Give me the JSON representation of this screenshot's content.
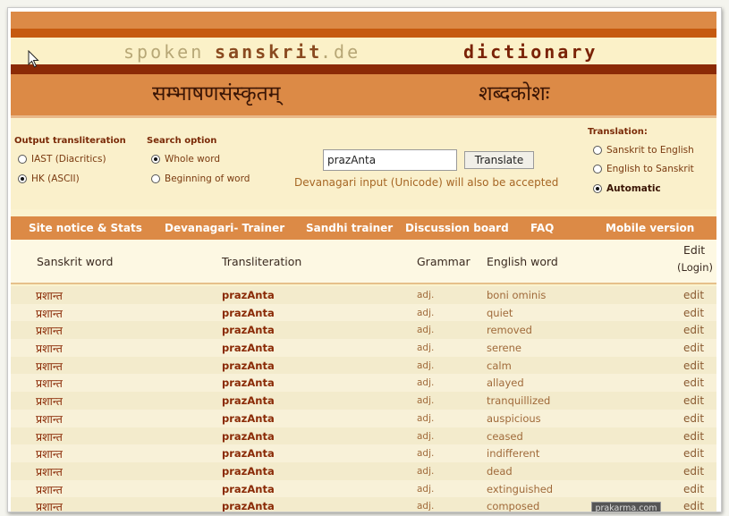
{
  "logo": {
    "spoken": "spoken",
    "sanskrit": "sanskrit",
    "domain": ".de",
    "dictionary": "dictionary"
  },
  "header_devanagari": {
    "left": "सम्भाषणसंस्कृतम्",
    "right": "शब्दकोशः"
  },
  "search": {
    "output_transliteration": {
      "label": "Output transliteration",
      "options": [
        "IAST (Diacritics)",
        "HK (ASCII)"
      ],
      "selected": "HK (ASCII)"
    },
    "search_option": {
      "label": "Search option",
      "options": [
        "Whole word",
        "Beginning of word"
      ],
      "selected": "Whole word"
    },
    "query_value": "prazAnta",
    "translate_label": "Translate",
    "hint": "Devanagari input (Unicode) will also be accepted",
    "translation": {
      "label": "Translation:",
      "options": [
        "Sanskrit to English",
        "English to Sanskrit",
        "Automatic"
      ],
      "selected": "Automatic"
    }
  },
  "nav": [
    "Site notice & Stats",
    "Devanagari- Trainer",
    "Sandhi trainer",
    "Discussion board",
    "FAQ",
    "Mobile version"
  ],
  "table": {
    "headers": {
      "sanskrit": "Sanskrit word",
      "translit": "Transliteration",
      "grammar": "Grammar",
      "english": "English word",
      "edit_top": "Edit",
      "edit_bottom": "(Login)"
    },
    "rows": [
      {
        "deva": "प्रशान्त",
        "translit": "prazAnta",
        "grammar": "adj.",
        "english": "boni ominis",
        "edit": "edit"
      },
      {
        "deva": "प्रशान्त",
        "translit": "prazAnta",
        "grammar": "adj.",
        "english": "quiet",
        "edit": "edit"
      },
      {
        "deva": "प्रशान्त",
        "translit": "prazAnta",
        "grammar": "adj.",
        "english": "removed",
        "edit": "edit"
      },
      {
        "deva": "प्रशान्त",
        "translit": "prazAnta",
        "grammar": "adj.",
        "english": "serene",
        "edit": "edit"
      },
      {
        "deva": "प्रशान्त",
        "translit": "prazAnta",
        "grammar": "adj.",
        "english": "calm",
        "edit": "edit"
      },
      {
        "deva": "प्रशान्त",
        "translit": "prazAnta",
        "grammar": "adj.",
        "english": "allayed",
        "edit": "edit"
      },
      {
        "deva": "प्रशान्त",
        "translit": "prazAnta",
        "grammar": "adj.",
        "english": "tranquillized",
        "edit": "edit"
      },
      {
        "deva": "प्रशान्त",
        "translit": "prazAnta",
        "grammar": "adj.",
        "english": "auspicious",
        "edit": "edit"
      },
      {
        "deva": "प्रशान्त",
        "translit": "prazAnta",
        "grammar": "adj.",
        "english": "ceased",
        "edit": "edit"
      },
      {
        "deva": "प्रशान्त",
        "translit": "prazAnta",
        "grammar": "adj.",
        "english": "indifferent",
        "edit": "edit"
      },
      {
        "deva": "प्रशान्त",
        "translit": "prazAnta",
        "grammar": "adj.",
        "english": "dead",
        "edit": "edit"
      },
      {
        "deva": "प्रशान्त",
        "translit": "prazAnta",
        "grammar": "adj.",
        "english": "extinguished",
        "edit": "edit"
      },
      {
        "deva": "प्रशान्त",
        "translit": "prazAnta",
        "grammar": "adj.",
        "english": "composed",
        "edit": "edit"
      }
    ]
  },
  "watermark": "prakarma.com",
  "colors": {
    "orange": "#dc8a46",
    "dark_red": "#8b2a06",
    "cream": "#fbf3cf"
  }
}
